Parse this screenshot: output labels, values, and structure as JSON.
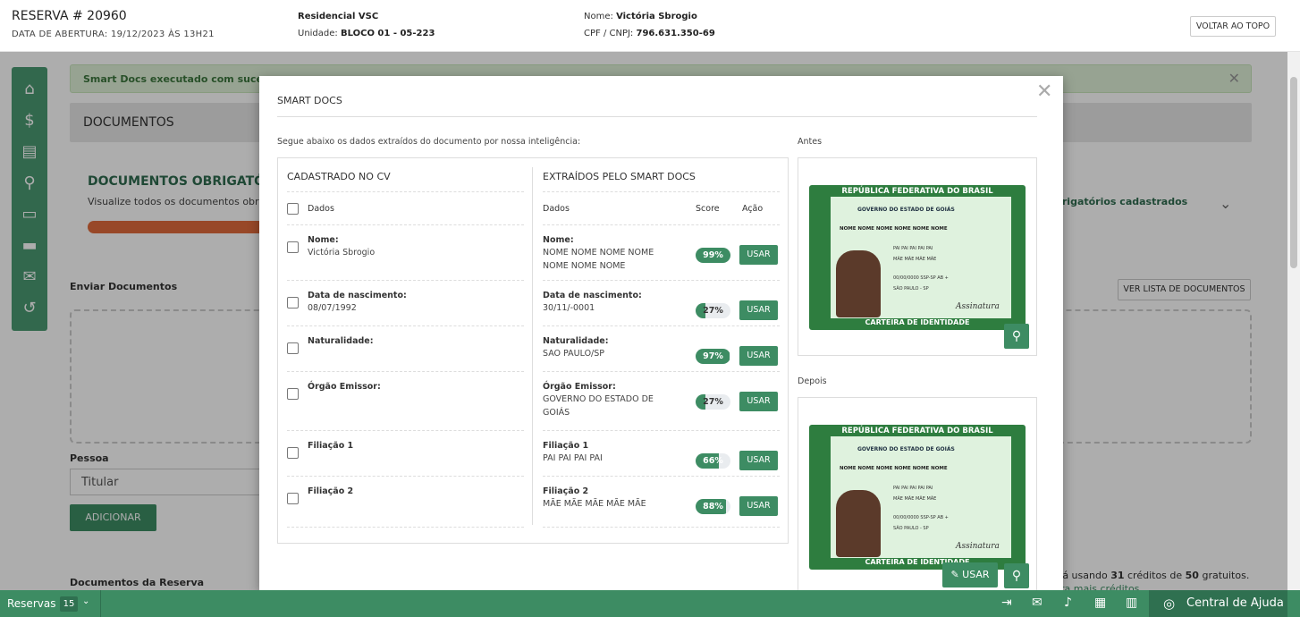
{
  "header": {
    "reserva": "RESERVA # 20960",
    "abertura": "DATA DE ABERTURA: 19/12/2023 ÀS 13H21",
    "empreendimento": "Residencial VSC",
    "unidade_label": "Unidade:",
    "unidade": "BLOCO 01 - 05-223",
    "nome_label": "Nome:",
    "nome": "Victória Sbrogio",
    "cpf_label": "CPF / CNPJ:",
    "cpf": "796.631.350-69",
    "voltar": "VOLTAR AO TOPO"
  },
  "sidebar": {
    "icons": [
      "home-icon",
      "dollar-icon",
      "invoice-icon",
      "search-dollar-icon",
      "document-icon",
      "folder-icon",
      "chat-icon",
      "history-icon"
    ]
  },
  "page": {
    "alert": "Smart Docs executado com sucesso",
    "documentos": "DOCUMENTOS",
    "obrigatorios_title": "DOCUMENTOS OBRIGATÓRIOS",
    "obrigatorios_sub": "Visualize todos os documentos obrigat",
    "obrigatorios_right": "brigatórios cadastrados",
    "enviar": "Enviar Documentos",
    "ver_lista": "VER LISTA DE DOCUMENTOS",
    "pessoa": "Pessoa",
    "pessoa_value": "Titular",
    "adicionar": "ADICIONAR",
    "doc_reserva": "Documentos da Reserva",
    "creditos_pre": "tá usando ",
    "creditos_usados": "31",
    "creditos_mid": " créditos de ",
    "creditos_total": "50",
    "creditos_post": " gratuitos.",
    "creditos_link": "ra mais créditos"
  },
  "modal": {
    "title": "SMART DOCS",
    "intro": "Segue abaixo os dados extraídos do documento por nossa inteligência:",
    "cadastrado_header": "CADASTRADO NO CV",
    "extraidos_header": "EXTRAÍDOS PELO SMART DOCS",
    "dados_label": "Dados",
    "score_label": "Score",
    "acao_label": "Ação",
    "usar_label": "USAR",
    "antes": "Antes",
    "depois": "Depois",
    "rows": [
      {
        "label": "Nome:",
        "cv_value": "Victória Sbrogio",
        "ext_value": "NOME NOME NOME NOME NOME NOME NOME",
        "score": 99
      },
      {
        "label": "Data de nascimento:",
        "cv_value": "08/07/1992",
        "ext_value": "30/11/-0001",
        "score": 27
      },
      {
        "label": "Naturalidade:",
        "cv_value": "",
        "ext_value": "SAO PAULO/SP",
        "score": 97
      },
      {
        "label": "Órgão Emissor:",
        "cv_value": "",
        "ext_value": "GOVERNO DO ESTADO DE GOIÁS",
        "score": 27
      },
      {
        "label": "Filiação 1",
        "cv_value": "",
        "ext_value": "PAI PAI PAI PAI",
        "score": 66
      },
      {
        "label": "Filiação 2",
        "cv_value": "",
        "ext_value": "MÃE MÃE MÃE MÃE MÃE",
        "score": 88
      }
    ],
    "card": {
      "header": "REPÚBLICA FEDERATIVA DO BRASIL",
      "gov": "GOVERNO DO ESTADO DE GOIÁS",
      "nome": "NOME NOME NOME NOME NOME NOME",
      "filiacao": "PAI PAI PAI PAI PAI",
      "mae": "MÃE MÃE MÃE MÃE",
      "nasc": "00/00/0000   SSP-SP   AB +",
      "natural": "SÃO PAULO - SP",
      "footer": "CARTEIRA DE IDENTIDADE",
      "assinatura": "Assinatura"
    }
  },
  "bottombar": {
    "reservas": "Reservas",
    "count": "15",
    "central": "Central de Ajuda"
  },
  "colors": {
    "accent": "#3d8c63",
    "orange": "#e06b3b"
  }
}
